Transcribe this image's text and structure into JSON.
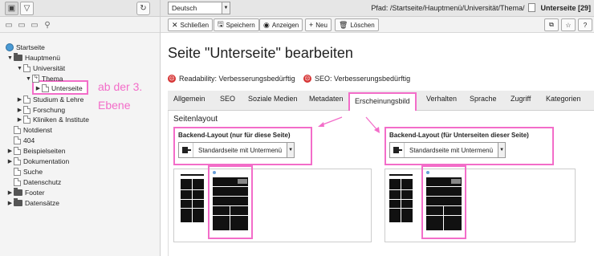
{
  "left_pane": {
    "tree": [
      {
        "label": "Startseite",
        "icon": "globe-icon"
      },
      {
        "label": "Hauptmenü",
        "icon": "folder-icon"
      },
      {
        "label": "Universität",
        "icon": "page-icon"
      },
      {
        "label": "Thema",
        "icon": "shortcut-page-icon"
      },
      {
        "label": "Unterseite",
        "icon": "page-icon"
      },
      {
        "label": "Studium & Lehre",
        "icon": "page-icon"
      },
      {
        "label": "Forschung",
        "icon": "page-icon"
      },
      {
        "label": "Kliniken & Institute",
        "icon": "page-icon"
      },
      {
        "label": "Notdienst",
        "icon": "page-icon"
      },
      {
        "label": "404",
        "icon": "page-icon"
      },
      {
        "label": "Beispielseiten",
        "icon": "page-icon"
      },
      {
        "label": "Dokumentation",
        "icon": "page-icon"
      },
      {
        "label": "Suche",
        "icon": "page-icon"
      },
      {
        "label": "Datenschutz",
        "icon": "page-icon"
      },
      {
        "label": "Footer",
        "icon": "folder-icon"
      },
      {
        "label": "Datensätze",
        "icon": "folder-icon"
      }
    ]
  },
  "annotation": {
    "line1": "ab der 3.",
    "line2": "Ebene"
  },
  "header": {
    "language": "Deutsch",
    "path_label": "Pfad: /Startseite/Hauptmenü/Universität/Thema/",
    "page_label": "Unterseite [29]"
  },
  "toolbar": {
    "close": "Schließen",
    "save": "Speichern",
    "view": "Anzeigen",
    "new": "Neu",
    "delete": "Löschen",
    "help": "?"
  },
  "main": {
    "title": "Seite \"Unterseite\" bearbeiten",
    "readability": "Readability: Verbesserungsbedürftig",
    "seo": "SEO: Verbesserungsbedürftig",
    "tabs": [
      "Allgemein",
      "SEO",
      "Soziale Medien",
      "Metadaten",
      "Erscheinungsbild",
      "Verhalten",
      "Sprache",
      "Zugriff",
      "Kategorien"
    ],
    "section_title": "Seitenlayout",
    "backend_layout": {
      "label": "Backend-Layout (nur für diese Seite)",
      "value": "Standardseite mit Untermenü"
    },
    "backend_layout_sub": {
      "label": "Backend-Layout (für Unterseiten dieser Seite)",
      "value": "Standardseite mit Untermenü"
    }
  },
  "colors": {
    "highlight": "#f36dc9",
    "status_bad": "#d63333"
  }
}
